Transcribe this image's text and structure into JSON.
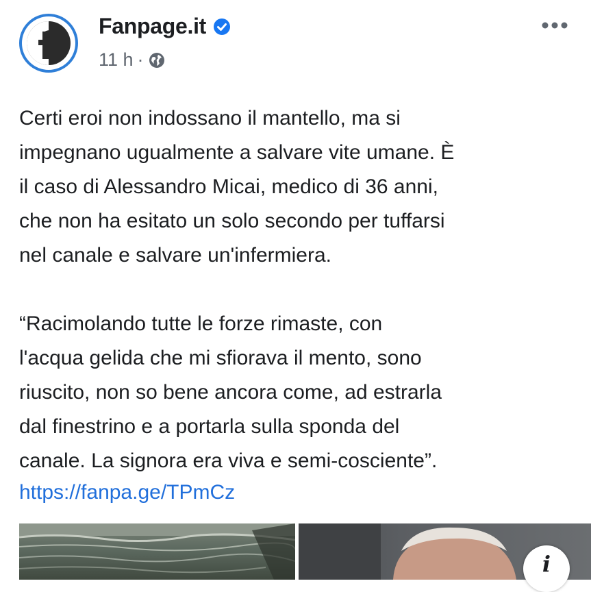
{
  "header": {
    "page_name": "Fanpage.it",
    "time": "11 h",
    "separator": "·",
    "verified_icon": "verified-badge-icon",
    "audience_icon": "globe-icon",
    "more_icon": "more-horizontal-icon",
    "logo_letter": "f"
  },
  "post": {
    "paragraph_1": "Certi eroi non indossano il mantello, ma si\nimpegnano ugualmente a salvare vite umane. È\nil caso di Alessandro Micai, medico di 36 anni,\nche non ha esitato un solo secondo per tuffarsi\nnel canale e salvare un'infermiera.",
    "paragraph_2": "“Racimolando tutte le forze rimaste, con\nl'acqua gelida che mi sfiorava il mento, sono\nriuscito, non so bene ancora come, ad estrarla\ndal finestrino e a portarla sulla sponda del\ncanale. La signora era viva e semi-cosciente”.",
    "link": "https://fanpa.ge/TPmCz"
  },
  "media": {
    "info_icon": "info-icon",
    "info_glyph": "i"
  },
  "colors": {
    "accent": "#2f7fd8",
    "link": "#216fdb",
    "text": "#1c1e21",
    "meta": "#606770"
  }
}
